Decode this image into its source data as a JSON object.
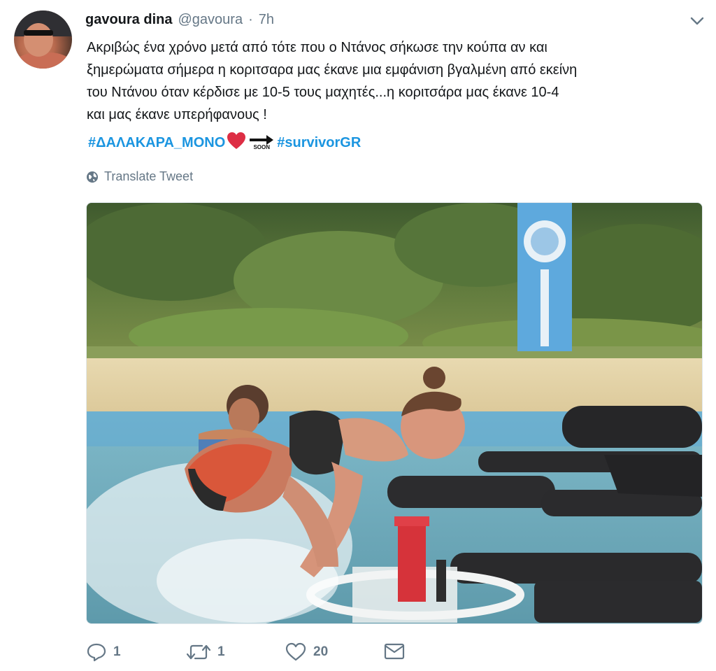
{
  "tweet": {
    "display_name": "gavoura dina",
    "handle": "@gavoura",
    "separator": "·",
    "time": "7h",
    "text_lines": [
      "Ακριβώς ένα χρόνο μετά από τότε που ο Ντάνος σήκωσε την κούπα αν και",
      "ξημερώματα σήμερα η κοριτσαρα μας έκανε μια εμφάνιση βγαλμένη από εκείνη",
      "του Ντάνου όταν κέρδισε με 10-5 τους μαχητές...η κοριτσάρα μας έκανε  10-4",
      "και μας έκανε υπερήφανους !"
    ],
    "hashtag_1": "#ΔΑΛΑΚΑΡΑ_ΜΟΝΟ",
    "soon_label": "SOON",
    "hashtag_2": "#survivorGR",
    "translate_label": "Translate Tweet"
  },
  "actions": {
    "reply_count": "1",
    "retweet_count": "1",
    "like_count": "20"
  },
  "icons": {
    "caret": "chevron-down-icon",
    "globe": "globe-icon",
    "reply": "reply-icon",
    "retweet": "retweet-icon",
    "like": "heart-icon",
    "message": "envelope-icon"
  },
  "colors": {
    "link": "#1b95e0",
    "muted": "#657786",
    "text": "#14171a"
  }
}
